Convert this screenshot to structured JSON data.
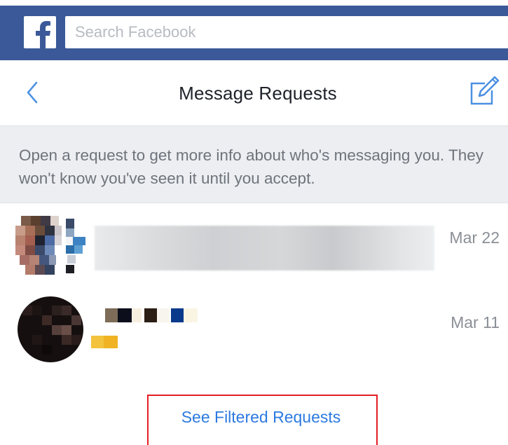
{
  "topbar": {
    "logo_letter": "f",
    "search_placeholder": "Search Facebook",
    "brand_color": "#3b5998"
  },
  "header": {
    "title": "Message Requests",
    "back_icon": "chevron-left-icon",
    "compose_icon": "compose-icon"
  },
  "info": {
    "text": "Open a request to get more info about who's messaging you. They won't know you've seen it until you accept."
  },
  "requests": [
    {
      "date": "Mar 22"
    },
    {
      "date": "Mar 11"
    }
  ],
  "footer": {
    "filtered_label": "See Filtered Requests",
    "link_color": "#2c7ae0",
    "highlight_color": "#e31e24"
  }
}
